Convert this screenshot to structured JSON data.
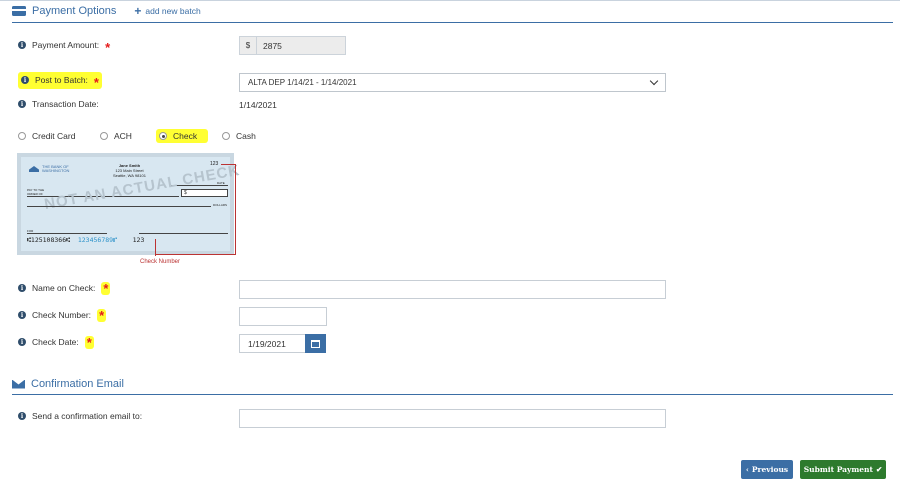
{
  "payment_options": {
    "title": "Payment Options",
    "add_batch_label": "add new batch",
    "icon": "credit-card-icon"
  },
  "fields": {
    "payment_amount": {
      "label": "Payment Amount:",
      "currency_prefix": "$",
      "value": "2875"
    },
    "post_to_batch": {
      "label": "Post to Batch:",
      "selected": "ALTA DEP 1/14/21 - 1/14/2021"
    },
    "transaction_date": {
      "label": "Transaction Date:",
      "value": "1/14/2021"
    },
    "name_on_check": {
      "label": "Name on Check:",
      "value": ""
    },
    "check_number": {
      "label": "Check Number:",
      "value": ""
    },
    "check_date": {
      "label": "Check Date:",
      "value": "1/19/2021"
    }
  },
  "required_marker": "*",
  "payment_methods": [
    {
      "label": "Credit Card",
      "checked": false
    },
    {
      "label": "ACH",
      "checked": false
    },
    {
      "label": "Check",
      "checked": true
    },
    {
      "label": "Cash",
      "checked": false
    }
  ],
  "check_image": {
    "bank_name_line1": "THE BANK OF",
    "bank_name_line2": "WASHINGTON",
    "holder_name": "Jane Smith",
    "holder_street": "123 Main Street",
    "holder_city": "Seattle, WA 98101",
    "check_no": "123",
    "date_label": "DATE",
    "pay_to_line1": "PAY TO THE",
    "pay_to_line2": "ORDER OF",
    "amount_symbol": "$",
    "dollars_label": "DOLLARS",
    "watermark": "NOT AN ACTUAL CHECK",
    "for_label": "FOR",
    "micr_routing": "⑆125108366⑆",
    "micr_account": "123456789⑈",
    "micr_check": "123",
    "callout_label": "Check Number"
  },
  "confirmation": {
    "title": "Confirmation Email",
    "icon": "envelope-icon",
    "email_label": "Send a confirmation email to:",
    "email_value": ""
  },
  "buttons": {
    "previous": "Previous",
    "submit": "Submit Payment"
  },
  "colors": {
    "accent": "#3b6ea5",
    "highlight": "#ffff33",
    "required": "#e41b1b",
    "submit": "#2d7a2d"
  }
}
